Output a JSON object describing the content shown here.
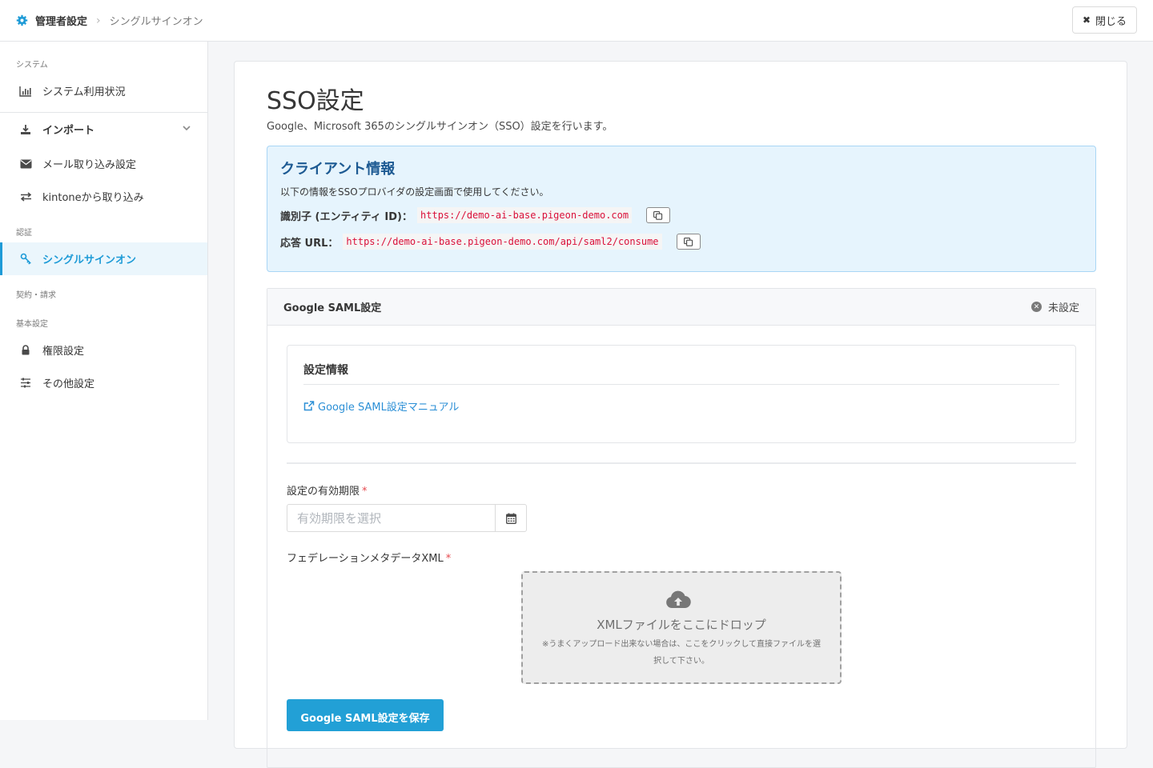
{
  "header": {
    "breadcrumb_root": "管理者設定",
    "breadcrumb_current": "シングルサインオン",
    "close_label": "閉じる"
  },
  "sidebar": {
    "sections": {
      "system": "システム",
      "auth": "認証",
      "contract": "契約・請求",
      "basic": "基本設定"
    },
    "items": {
      "usage": "システム利用状況",
      "import": "インポート",
      "mail_import": "メール取り込み設定",
      "kintone_import": "kintoneから取り込み",
      "sso": "シングルサインオン",
      "permissions": "権限設定",
      "other": "その他設定"
    },
    "active_item": "シングルサインオン"
  },
  "main": {
    "title": "SSO設定",
    "description": "Google、Microsoft 365のシングルサインオン（SSO）設定を行います。",
    "client_info": {
      "heading": "クライアント情報",
      "description": "以下の情報をSSOプロバイダの設定画面で使用してください。",
      "entity_id_label": "識別子 (エンティティ ID)：",
      "entity_id_value": "https://demo-ai-base.pigeon-demo.com",
      "reply_url_label": "応答 URL：",
      "reply_url_value": "https://demo-ai-base.pigeon-demo.com/api/saml2/consume"
    },
    "google_saml": {
      "title": "Google SAML設定",
      "status": "未設定",
      "info_heading": "設定情報",
      "manual_link": "Google SAML設定マニュアル",
      "expiry_label": "設定の有効期限",
      "expiry_placeholder": "有効期限を選択",
      "required_mark": "*",
      "xml_label": "フェデレーションメタデータXML",
      "dropzone_main": "XMLファイルをここにドロップ",
      "dropzone_sub": "※うまくアップロード出来ない場合は、ここをクリックして直接ファイルを選択して下さい。",
      "save_label": "Google SAML設定を保存"
    }
  },
  "colors": {
    "accent": "#1e9bd7",
    "primary_button": "#22a0d6",
    "client_box_bg": "#e6f4fd",
    "client_heading": "#1d5a93",
    "code_text": "#da1039",
    "required": "#e5484d"
  },
  "icons": {
    "breadcrumb": "gear-icon",
    "close": "close-icon",
    "usage": "bar-chart-icon",
    "import": "download-icon",
    "mail": "envelope-icon",
    "kintone": "exchange-icon",
    "sso": "key-icon",
    "permissions": "lock-icon",
    "other": "sliders-icon",
    "copy": "copy-icon",
    "status": "x-circle-icon",
    "manual_link": "external-link-icon",
    "calendar": "calendar-icon",
    "upload": "cloud-upload-icon"
  }
}
